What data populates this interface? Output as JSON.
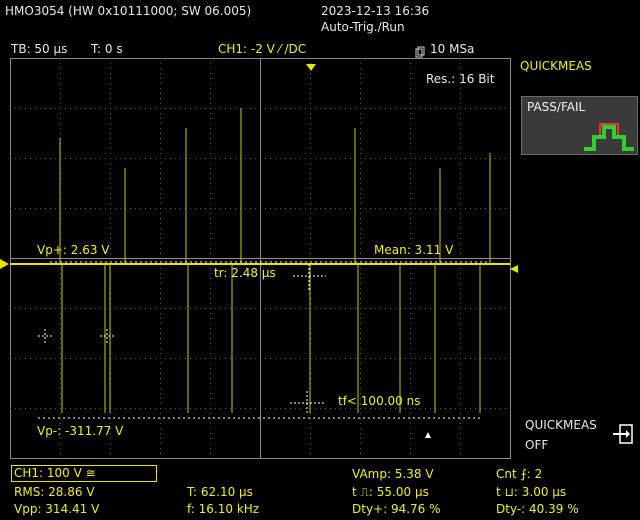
{
  "header": {
    "device": "HMO3054 (HW 0x10111000; SW 06.005)",
    "datetime": "2023-12-13 16:36",
    "trigger_mode": "Auto-Trig./Run"
  },
  "toolbar": {
    "timebase": "TB: 50 µs",
    "time_offset": "T: 0 s",
    "channel": "CH1: -2 V ⁄ /DC",
    "sample_rate": "10 MSa"
  },
  "screen": {
    "resolution": "Res.: 16 Bit",
    "vp_plus": "Vp+: 2.63 V",
    "mean": "Mean: 3.11 V",
    "rise_time": "tr: 2.48 µs",
    "fall_time": "tf< 100.00 ns",
    "vp_minus": "Vp-: -311.77 V",
    "trace_color": "#e6e600"
  },
  "side_menu": {
    "title": "QUICKMEAS",
    "pass_fail": "PASS/FAIL",
    "quickmeas_off_line1": "QUICKMEAS",
    "quickmeas_off_line2": "OFF",
    "icon_red": "#ff3030",
    "icon_green": "#30d030"
  },
  "measurements": {
    "ch1_scale": "CH1: 100 V ≅",
    "rms": "RMS: 28.86 V",
    "vpp": "Vpp: 314.41 V",
    "period": "T: 62.10 µs",
    "frequency": "f: 16.10 kHz",
    "vamp": "VAmp: 5.38 V",
    "pos_width": "t ⎍: 55.00 µs",
    "duty_pos": "Dty+: 94.76 %",
    "count": "Cnt ⨍: 2",
    "neg_width": "t ⊔: 3.00 µs",
    "duty_neg": "Dty-: 40.39 %"
  }
}
